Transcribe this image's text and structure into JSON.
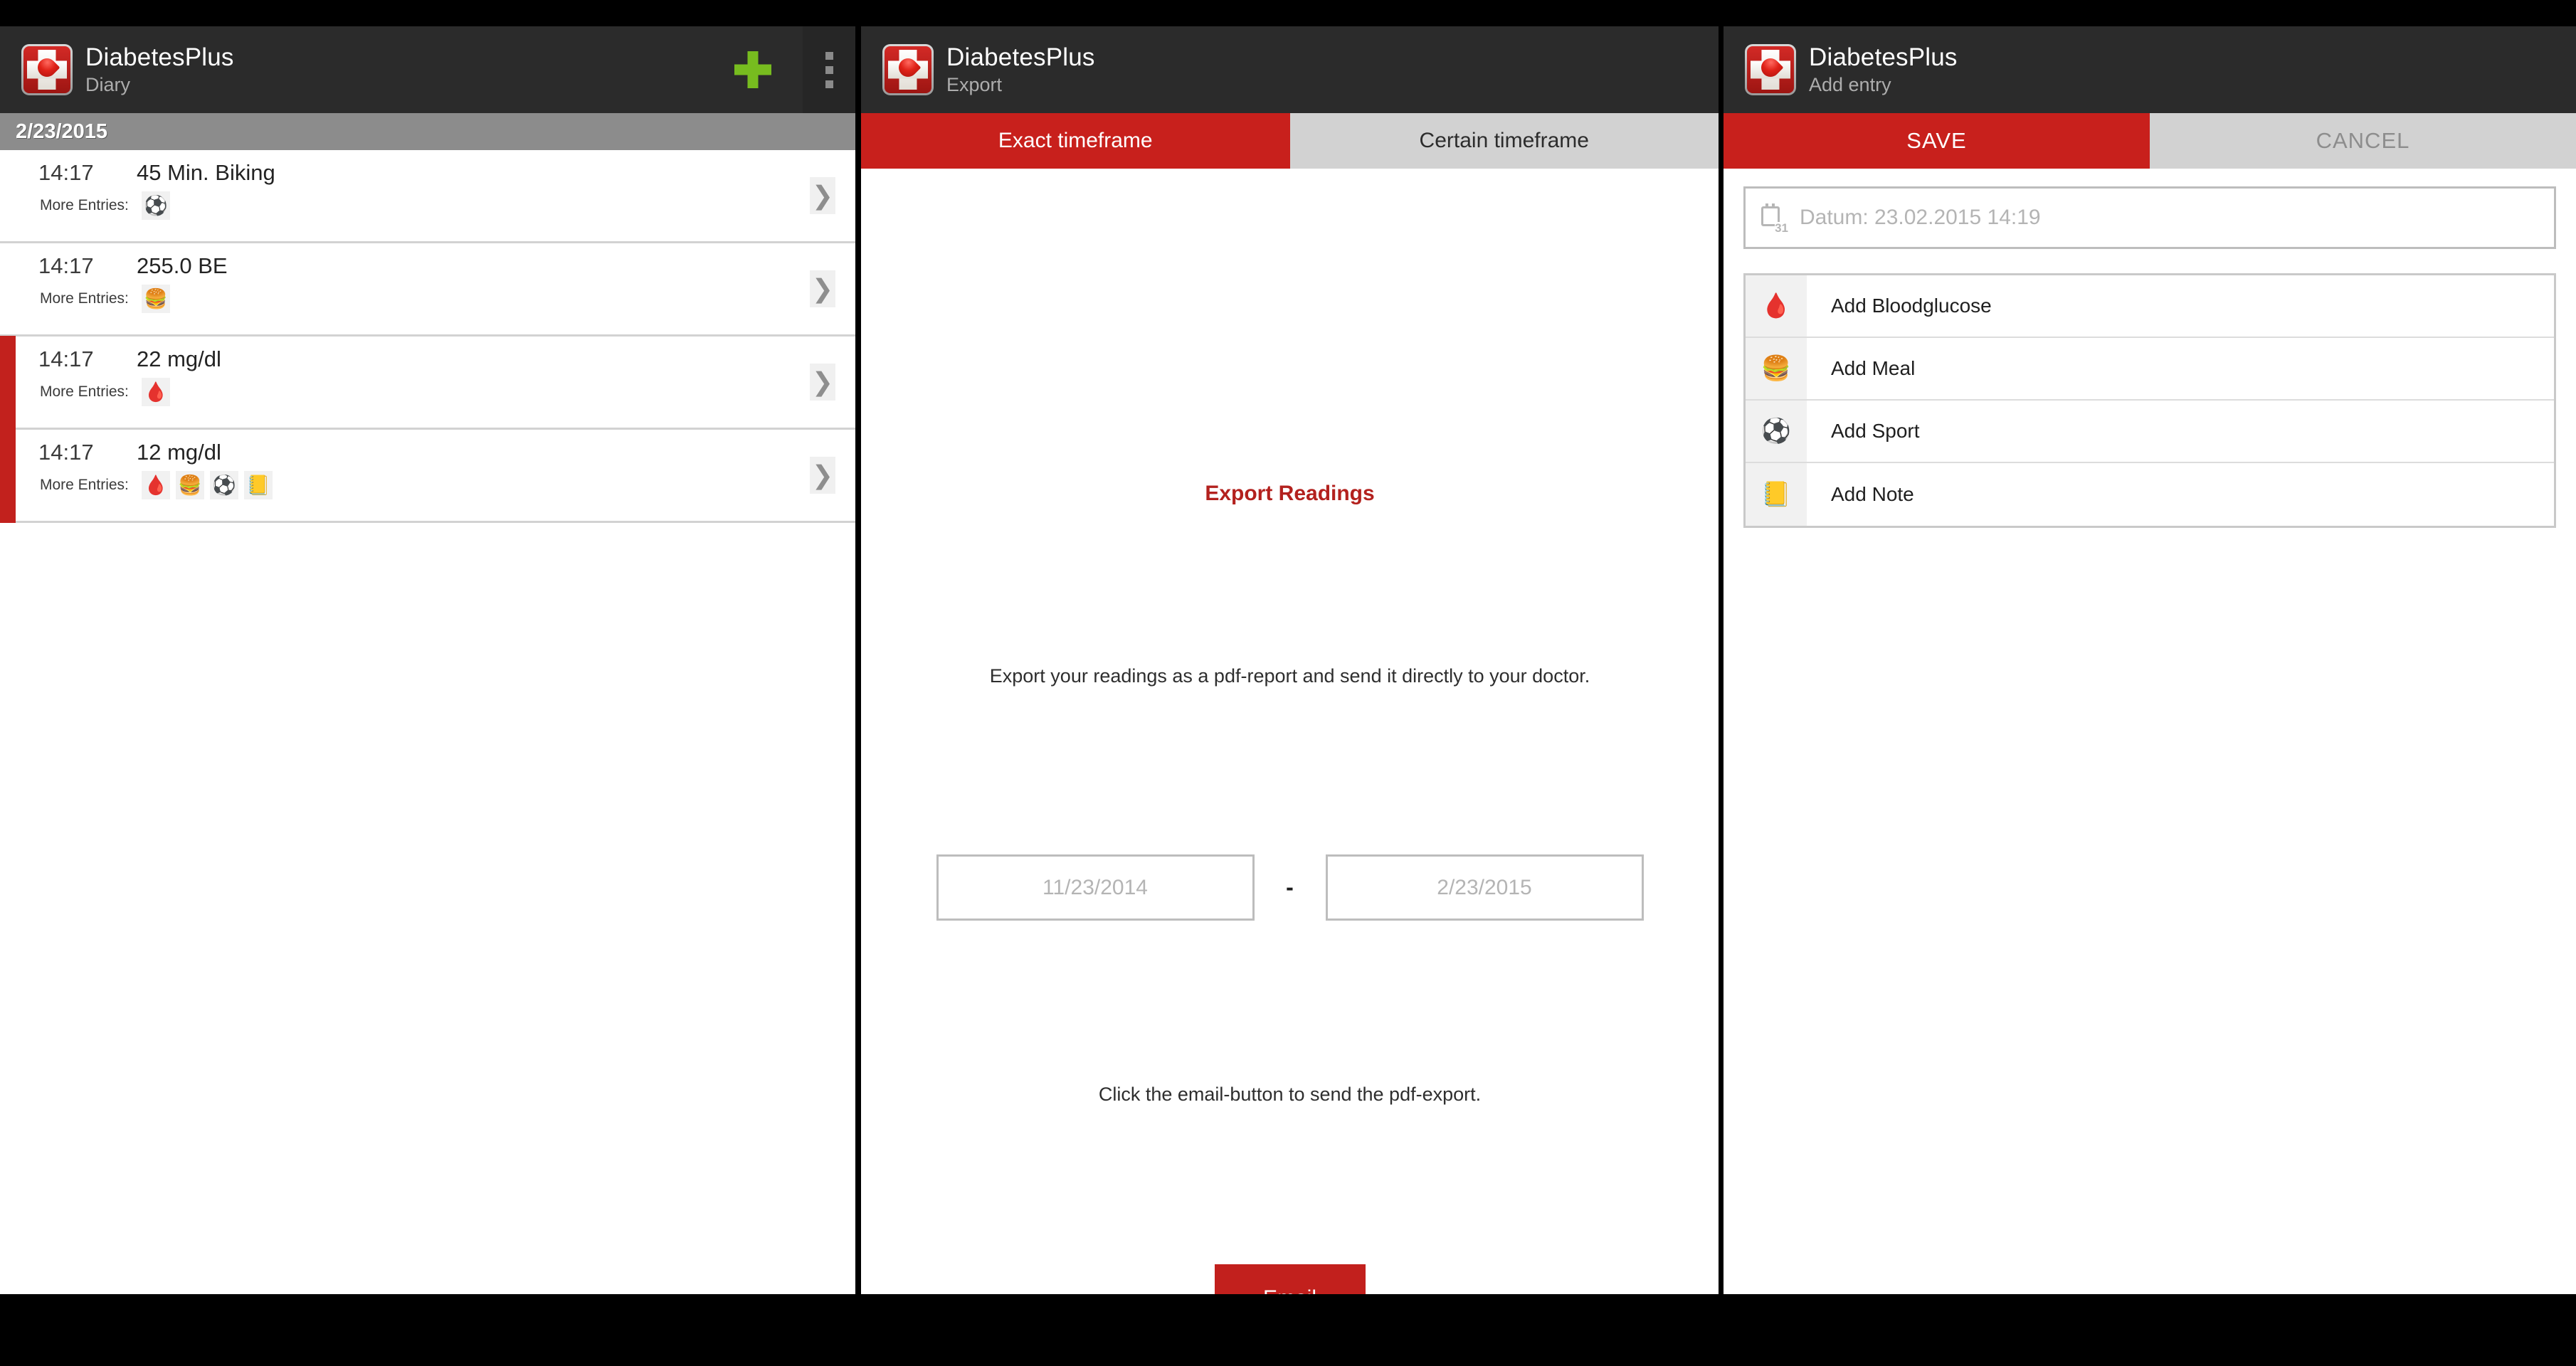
{
  "app": {
    "name": "DiabetesPlus",
    "icon": "app-logo-red-cross-blood-drop"
  },
  "panels": {
    "diary": {
      "subtitle": "Diary",
      "add_icon": "plus-icon",
      "overflow_icon": "overflow-menu-icon",
      "date_header": "2/23/2015",
      "more_entries_label": "More Entries:",
      "chevron": "❯",
      "entries": [
        {
          "time": "14:17",
          "value": "45 Min. Biking",
          "icons": [
            "⚽"
          ],
          "icon_names": [
            "sport-icon"
          ],
          "accent": false
        },
        {
          "time": "14:17",
          "value": "255.0 BE",
          "icons": [
            "🍔"
          ],
          "icon_names": [
            "meal-icon"
          ],
          "accent": false
        },
        {
          "time": "14:17",
          "value": "22 mg/dl",
          "icons": [
            "🩸"
          ],
          "icon_names": [
            "bloodglucose-icon"
          ],
          "accent": true
        },
        {
          "time": "14:17",
          "value": "12 mg/dl",
          "icons": [
            "🩸",
            "🍔",
            "⚽",
            "📒"
          ],
          "icon_names": [
            "bloodglucose-icon",
            "meal-icon",
            "sport-icon",
            "note-icon"
          ],
          "accent": true
        }
      ]
    },
    "export": {
      "subtitle": "Export",
      "tabs": [
        {
          "label": "Exact timeframe",
          "active": true
        },
        {
          "label": "Certain timeframe",
          "active": false
        }
      ],
      "heading": "Export Readings",
      "description": "Export your readings as a pdf-report and send it directly to your doctor.",
      "date_from_placeholder": "11/23/2014",
      "date_to_placeholder": "2/23/2015",
      "date_separator": "-",
      "hint": "Click the email-button to send the pdf-export.",
      "email_button": "Email"
    },
    "add_entry": {
      "subtitle": "Add entry",
      "save_label": "SAVE",
      "cancel_label": "CANCEL",
      "datum_value": "Datum: 23.02.2015 14:19",
      "calendar_icon_day": "31",
      "items": [
        {
          "label": "Add Bloodglucose",
          "icon": "🩸",
          "icon_name": "bloodglucose-icon"
        },
        {
          "label": "Add Meal",
          "icon": "🍔",
          "icon_name": "meal-icon"
        },
        {
          "label": "Add Sport",
          "icon": "⚽",
          "icon_name": "sport-icon"
        },
        {
          "label": "Add Note",
          "icon": "📒",
          "icon_name": "note-icon"
        }
      ]
    }
  },
  "colors": {
    "brand_red": "#c8201c",
    "action_bar": "#2b2b2b",
    "date_header": "#8c8c8c",
    "accent_bar": "#c2211d",
    "plus_green": "#77bc1f"
  }
}
